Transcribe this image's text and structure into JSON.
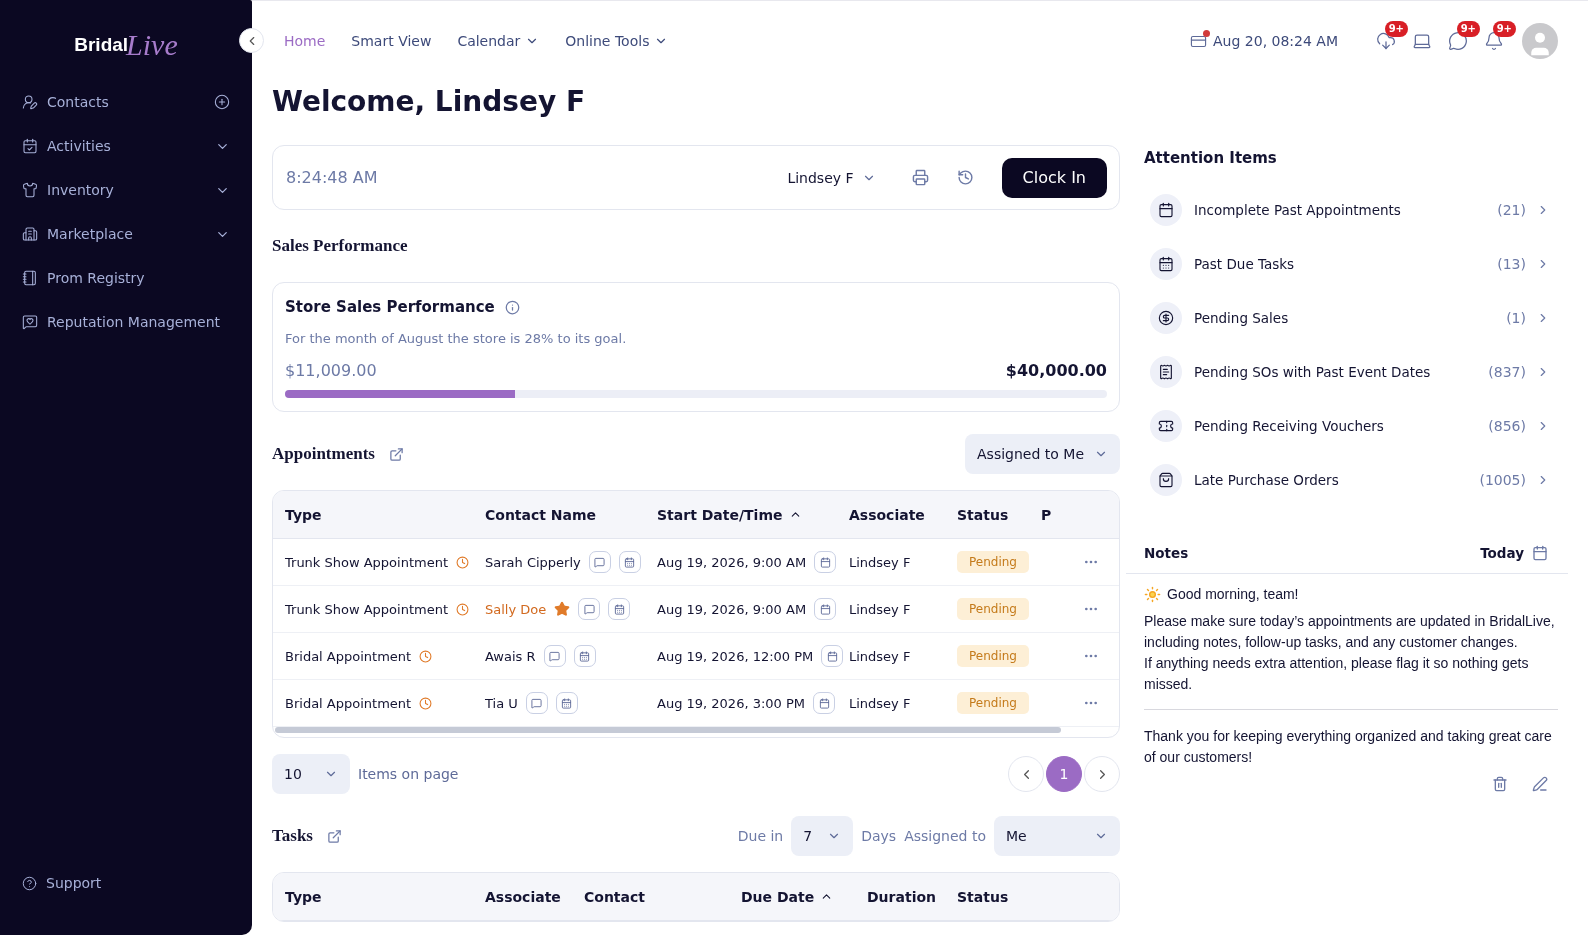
{
  "sidebar": {
    "logo": {
      "primary": "Bridal",
      "script": "Live"
    },
    "items": [
      {
        "label": "Contacts",
        "kind": "add"
      },
      {
        "label": "Activities",
        "kind": "expand"
      },
      {
        "label": "Inventory",
        "kind": "expand"
      },
      {
        "label": "Marketplace",
        "kind": "expand"
      },
      {
        "label": "Prom Registry",
        "kind": "plain"
      },
      {
        "label": "Reputation Management",
        "kind": "plain"
      }
    ],
    "footer": {
      "label": "Support"
    }
  },
  "nav": {
    "items": [
      {
        "label": "Home",
        "selected": true,
        "dropdown": false
      },
      {
        "label": "Smart View",
        "selected": false,
        "dropdown": false
      },
      {
        "label": "Calendar",
        "selected": false,
        "dropdown": true
      },
      {
        "label": "Online Tools",
        "selected": false,
        "dropdown": true
      }
    ],
    "datetime": "Aug 20, 08:24 AM",
    "badges": [
      {
        "kind": "badge",
        "count": "9+"
      },
      {
        "kind": "plain"
      },
      {
        "kind": "badge",
        "count": "9+"
      },
      {
        "kind": "badge",
        "count": "9+"
      }
    ]
  },
  "welcome": "Welcome, Lindsey F",
  "clock": {
    "time": "8:24:48 AM",
    "user": "Lindsey F",
    "button": "Clock In"
  },
  "sales": {
    "heading": "Sales Performance",
    "title": "Store Sales Performance",
    "summary": "For the month of August the store is 28% to its goal.",
    "current": "$11,009.00",
    "goal": "$40,000.00",
    "level": 0.28
  },
  "appointments": {
    "heading": "Appointments",
    "filter": "Assigned to Me",
    "columns": [
      {
        "label": "Type",
        "sorted": false
      },
      {
        "label": "Contact Name",
        "sorted": false
      },
      {
        "label": "Start Date/Time",
        "sorted": true
      },
      {
        "label": "Associate",
        "sorted": false
      },
      {
        "label": "Status",
        "sorted": false
      },
      {
        "label": "P",
        "sorted": false
      }
    ],
    "rows": [
      {
        "type": "Trunk Show Appointment",
        "contact": "Sarah Cipperly",
        "starred": false,
        "start": "Aug 19, 2026, 9:00 AM",
        "associate": "Lindsey F",
        "status": "Pending"
      },
      {
        "type": "Trunk Show Appointment",
        "contact": "Sally Doe",
        "starred": true,
        "start": "Aug 19, 2026, 9:00 AM",
        "associate": "Lindsey F",
        "status": "Pending"
      },
      {
        "type": "Bridal Appointment",
        "contact": "Awais R",
        "starred": false,
        "start": "Aug 19, 2026, 12:00 PM",
        "associate": "Lindsey F",
        "status": "Pending"
      },
      {
        "type": "Bridal Appointment",
        "contact": "Tia U",
        "starred": false,
        "start": "Aug 19, 2026, 3:00 PM",
        "associate": "Lindsey F",
        "status": "Pending"
      }
    ],
    "page_size": "10",
    "page_size_label": "Items on page",
    "pages": [
      {
        "label": "1",
        "selected": true
      }
    ]
  },
  "tasks": {
    "heading": "Tasks",
    "due_label": "Due in",
    "due_value": "7",
    "days_label": "Days",
    "assigned_label": "Assigned to",
    "assigned_value": "Me",
    "columns": [
      {
        "label": "Type",
        "sorted": false
      },
      {
        "label": "Associate",
        "sorted": false
      },
      {
        "label": "Contact",
        "sorted": false
      },
      {
        "label": "Due Date",
        "sorted": true
      },
      {
        "label": "Duration",
        "sorted": false
      },
      {
        "label": "Status",
        "sorted": false
      }
    ]
  },
  "attention": {
    "title": "Attention Items",
    "items": [
      {
        "label": "Incomplete Past Appointments",
        "count": "(21)"
      },
      {
        "label": "Past Due Tasks",
        "count": "(13)"
      },
      {
        "label": "Pending Sales",
        "count": "(1)"
      },
      {
        "label": "Pending SOs with Past Event Dates",
        "count": "(837)"
      },
      {
        "label": "Pending Receiving Vouchers",
        "count": "(856)"
      },
      {
        "label": "Late Purchase Orders",
        "count": "(1005)"
      }
    ]
  },
  "notes": {
    "title": "Notes",
    "date": "Today",
    "greeting": "Good morning, team!",
    "body": [
      "Please make sure today’s appointments are updated in BridalLive, including notes, follow-up tasks, and any customer changes.",
      "If anything needs extra attention, please flag it so nothing gets missed."
    ],
    "closing": "Thank you for keeping everything organized and taking great care of our customers!"
  }
}
